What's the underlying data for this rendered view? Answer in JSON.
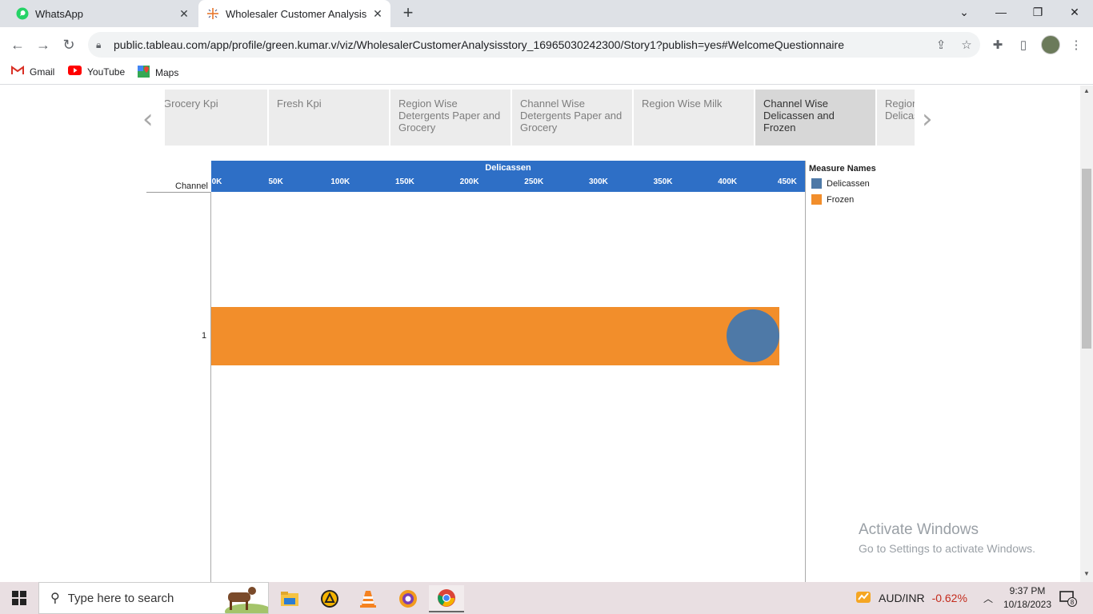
{
  "browser": {
    "tabs": [
      {
        "title": "WhatsApp",
        "icon": "whatsapp-icon",
        "active": false
      },
      {
        "title": "Wholesaler Customer Analysis st",
        "icon": "tableau-icon",
        "active": true
      }
    ],
    "url": "public.tableau.com/app/profile/green.kumar.v/viz/WholesalerCustomerAnalysisstory_16965030242300/Story1?publish=yes#WelcomeQuestionnaire",
    "bookmarks": [
      {
        "label": "Gmail",
        "icon": "gmail-icon"
      },
      {
        "label": "YouTube",
        "icon": "youtube-icon"
      },
      {
        "label": "Maps",
        "icon": "maps-icon"
      }
    ]
  },
  "story": {
    "points": [
      {
        "label": "Grocery Kpi",
        "active": false
      },
      {
        "label": "Fresh Kpi",
        "active": false
      },
      {
        "label": "Region Wise Detergents Paper and Grocery",
        "active": false
      },
      {
        "label": "Channel Wise Detergents Paper and Grocery",
        "active": false
      },
      {
        "label": "Region Wise Milk",
        "active": false
      },
      {
        "label": "Channel Wise Delicassen and Frozen",
        "active": true
      },
      {
        "label": "Region Wise Delicassen",
        "active": false
      }
    ]
  },
  "chart_data": {
    "type": "bar",
    "title": "Delicassen",
    "row_header": "Channel",
    "categories": [
      "1"
    ],
    "xlim": [
      0,
      460000
    ],
    "x_ticks": [
      {
        "value": 0,
        "label": "0K"
      },
      {
        "value": 50000,
        "label": "50K"
      },
      {
        "value": 100000,
        "label": "100K"
      },
      {
        "value": 150000,
        "label": "150K"
      },
      {
        "value": 200000,
        "label": "200K"
      },
      {
        "value": 250000,
        "label": "250K"
      },
      {
        "value": 300000,
        "label": "300K"
      },
      {
        "value": 350000,
        "label": "350K"
      },
      {
        "value": 400000,
        "label": "400K"
      },
      {
        "value": 450000,
        "label": "450K"
      }
    ],
    "series": [
      {
        "name": "Frozen",
        "mark": "bar",
        "color": "#f28e2b",
        "values": [
          440000
        ]
      },
      {
        "name": "Delicassen",
        "mark": "circle",
        "color": "#4e79a7",
        "values": [
          420000
        ]
      }
    ],
    "legend": {
      "title": "Measure Names",
      "placement": "right",
      "items": [
        {
          "name": "Delicassen",
          "color": "#4e79a7"
        },
        {
          "name": "Frozen",
          "color": "#f28e2b"
        }
      ]
    }
  },
  "watermark": {
    "line1": "Activate Windows",
    "line2": "Go to Settings to activate Windows."
  },
  "taskbar": {
    "search_placeholder": "Type here to search",
    "apps": [
      "file-explorer-icon",
      "app-triangle-icon",
      "vlc-icon",
      "browser-shield-icon",
      "chrome-icon"
    ],
    "stock": {
      "pair": "AUD/INR",
      "change": "-0.62%"
    },
    "time": "9:37 PM",
    "date": "10/18/2023",
    "notifications": "8"
  }
}
